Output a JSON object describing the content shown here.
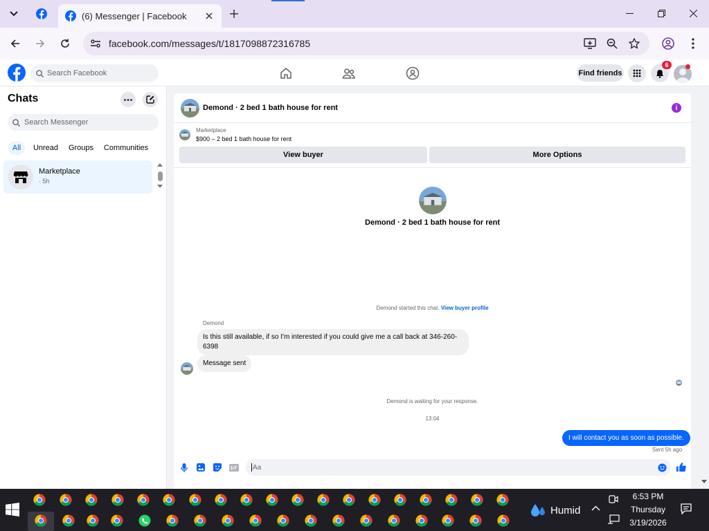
{
  "browser": {
    "active_tab_title": "(6) Messenger | Facebook",
    "url": "facebook.com/messages/t/1817098872316785"
  },
  "fb_header": {
    "search_placeholder": "Search Facebook",
    "find_friends_label": "Find friends",
    "notification_count": "6"
  },
  "sidebar": {
    "title": "Chats",
    "search_placeholder": "Search Messenger",
    "filters": [
      "All",
      "Unread",
      "Groups",
      "Communities"
    ],
    "active_filter": "All",
    "chats": [
      {
        "name": "Marketplace",
        "time": "· 5h"
      }
    ]
  },
  "conversation": {
    "title": "Demond · 2 bed 1 bath house for rent",
    "marketplace_label": "Marketplace",
    "listing": "$900 – 2 bed 1 bath house for rent",
    "view_buyer_label": "View buyer",
    "more_options_label": "More Options",
    "started_note": "Demond started this chat.",
    "view_buyer_profile_link": "View buyer profile",
    "sender_name": "Demond",
    "incoming_messages": [
      "Is this still available, if so I'm interested if you could give me a call back at 346-260-6398",
      "Message sent"
    ],
    "waiting_note": "Demond is waiting for your response.",
    "timestamp": "13:04",
    "outgoing_message": "I will contact you as soon as possible.",
    "sent_status": "Sent 5h ago",
    "composer_placeholder": "Aa"
  },
  "taskbar": {
    "weather": "Humid",
    "time": "6:53 PM",
    "day": "Thursday",
    "date": "3/19/2026"
  },
  "colors": {
    "fb_blue": "#0866ff",
    "tab_strip": "#e6dff3",
    "badge_red": "#e41e3f",
    "info_purple": "#9a2bd6"
  }
}
